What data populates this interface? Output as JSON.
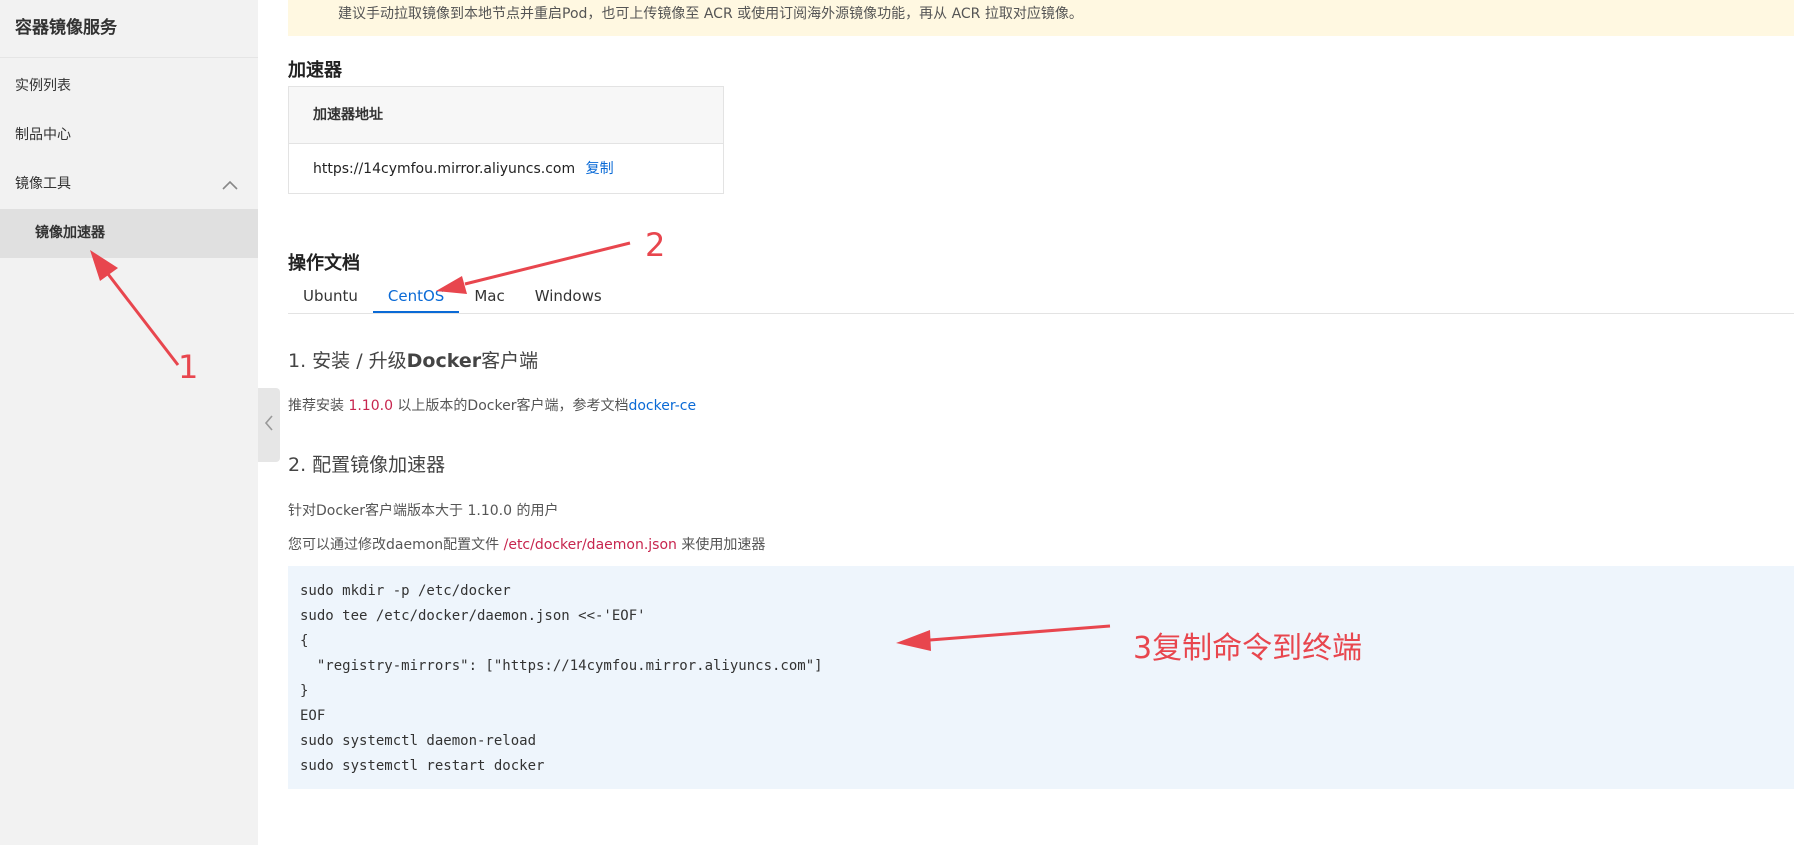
{
  "sidebar": {
    "title": "容器镜像服务",
    "items": [
      {
        "label": "实例列表"
      },
      {
        "label": "制品中心"
      },
      {
        "label": "镜像工具"
      }
    ],
    "sub_item": {
      "label": "镜像加速器"
    }
  },
  "notice": {
    "text": "建议手动拉取镜像到本地节点并重启Pod，也可上传镜像至 ACR 或使用订阅海外源镜像功能，再从 ACR 拉取对应镜像。"
  },
  "accelerator": {
    "section_title": "加速器",
    "header": "加速器地址",
    "url": "https://14cymfou.mirror.aliyuncs.com",
    "copy_label": "复制"
  },
  "docs": {
    "section_title": "操作文档",
    "tabs": [
      {
        "label": "Ubuntu"
      },
      {
        "label": "CentOS"
      },
      {
        "label": "Mac"
      },
      {
        "label": "Windows"
      }
    ],
    "active_tab": "CentOS",
    "step1": {
      "prefix": "1. 安装 / 升级",
      "bold": "Docker",
      "suffix": "客户端",
      "text_before": "推荐安装 ",
      "version": "1.10.0",
      "text_middle": " 以上版本的Docker客户端，参考文档",
      "link": "docker-ce"
    },
    "step2": {
      "title": "2. 配置镜像加速器",
      "line1": "针对Docker客户端版本大于 1.10.0 的用户",
      "line2_before": "您可以通过修改daemon配置文件 ",
      "line2_path": "/etc/docker/daemon.json",
      "line2_after": " 来使用加速器"
    },
    "code_lines": [
      "sudo mkdir -p /etc/docker",
      "sudo tee /etc/docker/daemon.json <<-'EOF'",
      "{",
      "  \"registry-mirrors\": [\"https://14cymfou.mirror.aliyuncs.com\"]",
      "}",
      "EOF",
      "sudo systemctl daemon-reload",
      "sudo systemctl restart docker"
    ]
  },
  "annotations": {
    "num1": "1",
    "num2": "2",
    "text3": "3复制命令到终端",
    "color": "#e8464e"
  },
  "colors": {
    "link": "#0a6ad6",
    "code_path": "#c7254e",
    "sidebar_bg": "#f2f2f2",
    "notice_bg": "#fff8e1",
    "code_bg": "#eef5fc"
  },
  "icons": {
    "sidebar_group": "chevron-up-icon",
    "collapse_handle": "chevron-left-icon"
  }
}
